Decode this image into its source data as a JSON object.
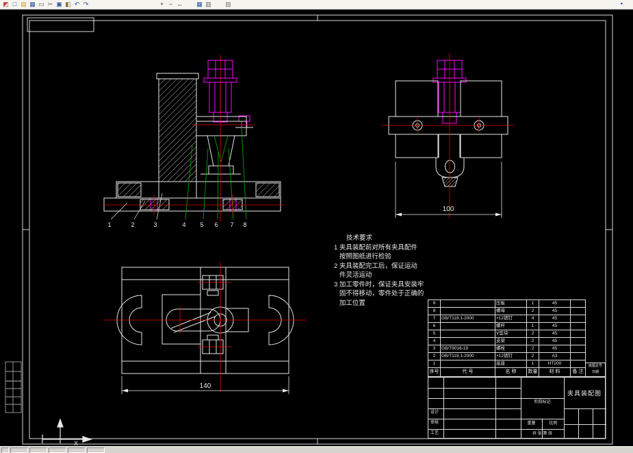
{
  "toolbar": {
    "icons_main": [
      {
        "name": "app-menu-icon",
        "glyph": "◩",
        "color": "#c23b3b"
      },
      {
        "name": "new-file-icon",
        "glyph": "□",
        "color": "#2d4f9e"
      },
      {
        "name": "open-folder-icon",
        "glyph": "▤",
        "color": "#c8962d"
      },
      {
        "name": "save-icon",
        "glyph": "▦",
        "color": "#2d4f9e"
      },
      {
        "name": "print-icon",
        "glyph": "▭",
        "color": "#5a5a5a"
      },
      {
        "name": "cut-icon",
        "glyph": "✂",
        "color": "#6a6a6a"
      },
      {
        "name": "copy-icon",
        "glyph": "▣",
        "color": "#2d4f9e"
      },
      {
        "name": "paste-icon",
        "glyph": "◧",
        "color": "#8a6a2f"
      },
      {
        "name": "undo-icon",
        "glyph": "↶",
        "color": "#2d4f9e"
      },
      {
        "name": "redo-icon",
        "glyph": "↷",
        "color": "#2d4f9e"
      }
    ],
    "icons_zoom": [
      {
        "name": "zoom-in-icon",
        "glyph": "+",
        "color": "#444444"
      },
      {
        "name": "zoom-out-icon",
        "glyph": "−",
        "color": "#444444"
      },
      {
        "name": "pan-icon",
        "glyph": "↔",
        "color": "#444444"
      }
    ],
    "icons_view": [
      {
        "name": "grid-icon",
        "glyph": "▦",
        "color": "#2d4f9e"
      },
      {
        "name": "layers-icon",
        "glyph": "▥",
        "color": "#666666"
      }
    ],
    "icons_extra": [
      {
        "name": "properties-icon",
        "glyph": "▧",
        "color": "#777777"
      }
    ],
    "icons_right": [
      {
        "name": "window-icon",
        "glyph": "▪",
        "color": "#1c4fa0"
      }
    ]
  },
  "drawing": {
    "part_labels": [
      "1",
      "2",
      "3",
      "4",
      "5",
      "6",
      "7",
      "8"
    ],
    "dim_side": "100",
    "dim_top": "140",
    "ucs_label": "X"
  },
  "tech": {
    "title": "技术要求",
    "lines": [
      "1 夹具装配前对所有夹具配件",
      "   按照图纸进行检验",
      "2 夹具装配完工后，保证运动",
      "   件灵活运动",
      "3 加工零件时，保证夹具安装牢",
      "   固不得移动，零件处于正确的",
      "   加工位置"
    ]
  },
  "bom": {
    "header": {
      "num": "序号",
      "code": "代  号",
      "name": "名  称",
      "qty": "数量",
      "material": "材  料",
      "note": "备 注"
    },
    "rows": [
      {
        "num": "9",
        "code": "",
        "name": "压板",
        "qty": "1",
        "material": "45",
        "note": ""
      },
      {
        "num": "8",
        "code": "",
        "name": "螺母",
        "qty": "2",
        "material": "45",
        "note": ""
      },
      {
        "num": "7",
        "code": "GB/T119.1-2000",
        "name": "×12销钉",
        "qty": "4",
        "material": "45",
        "note": ""
      },
      {
        "num": "6",
        "code": "",
        "name": "螺杆",
        "qty": "1",
        "material": "45",
        "note": ""
      },
      {
        "num": "5",
        "code": "",
        "name": "V型块",
        "qty": "2",
        "material": "45",
        "note": ""
      },
      {
        "num": "4",
        "code": "",
        "name": "支架",
        "qty": "2",
        "material": "45",
        "note": ""
      },
      {
        "num": "3",
        "code": "GB/T9016-19",
        "name": "螺栓",
        "qty": "2",
        "material": "45",
        "note": ""
      },
      {
        "num": "2",
        "code": "GB/T119.1-2000",
        "name": "×12销钉",
        "qty": "2",
        "material": "A3",
        "note": ""
      },
      {
        "num": "1",
        "code": "",
        "name": "底座",
        "qty": "1",
        "material": "HT200",
        "note": ""
      }
    ]
  },
  "titleblock": {
    "title": "夹具装配图",
    "left_labels": [
      "设计",
      "审核",
      "工艺"
    ],
    "mid_top": "阶段标记",
    "mid_cells": [
      "重量",
      "比例"
    ],
    "pages": "共 张 第 张",
    "corner_lines": [
      "底图总号",
      "日期"
    ]
  }
}
